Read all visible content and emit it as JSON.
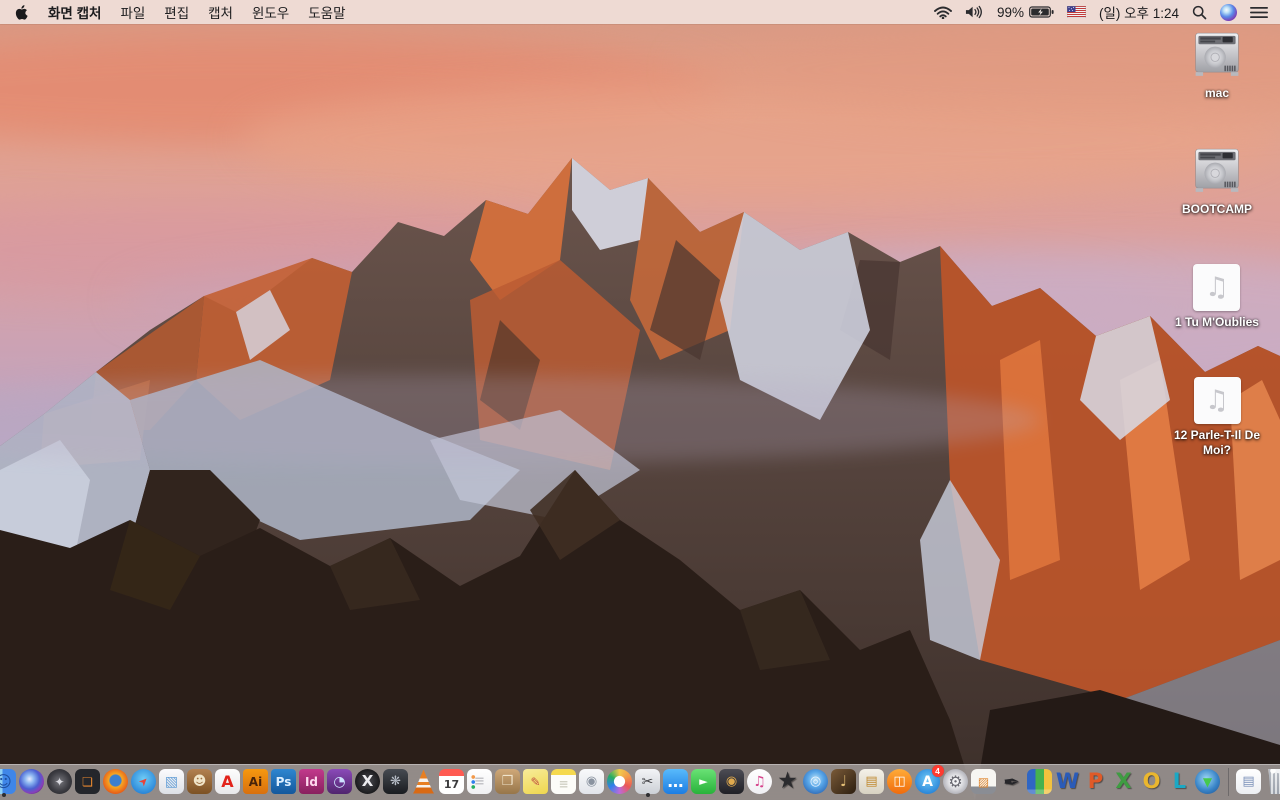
{
  "menu_bar": {
    "app_name": "화면 캡처",
    "menus": [
      "파일",
      "편집",
      "캡처",
      "윈도우",
      "도움말"
    ],
    "status": {
      "battery_percent": "99%",
      "clock": "(일) 오후 1:24",
      "icons": [
        "wifi-icon",
        "volume-icon",
        "battery-charging-icon",
        "us-flag-input-icon",
        "spotlight-icon",
        "siri-icon",
        "notification-center-icon"
      ]
    }
  },
  "desktop": {
    "audio_glyph": "♫",
    "icons": [
      {
        "label": "mac",
        "type": "drive"
      },
      {
        "label": "BOOTCAMP",
        "type": "drive"
      },
      {
        "label": "1 Tu M'Oublies",
        "type": "audio"
      },
      {
        "label": "12 Parle-T-Il De Moi?",
        "type": "audio"
      }
    ]
  },
  "dock": {
    "items": [
      {
        "name": "finder",
        "shape": "round",
        "bg": "linear-gradient(90deg,#8fd0f5 0 46%,#3f86e8 46%)",
        "glyph": "☺",
        "fg": "#1d4fa0",
        "fs": 16,
        "running": true
      },
      {
        "name": "siri",
        "shape": "circle",
        "bg": "radial-gradient(circle at 42% 40%,#e8ecff 0%,#8ab4f0 22%,#4a5fd0 48%,#8a3fb8 68%,#141c30 95%)",
        "glyph": ""
      },
      {
        "name": "launchpad",
        "shape": "circle",
        "bg": "radial-gradient(circle,#77777d 0%,#3c3c42 55%,#202024 100%)",
        "glyph": "✦",
        "fg": "#d8d8de",
        "fs": 12
      },
      {
        "name": "mission-control",
        "shape": "round",
        "bg": "#24262b",
        "glyph": "❏",
        "fg": "#e8882f",
        "fs": 12
      },
      {
        "name": "firefox",
        "shape": "circle",
        "bg": "radial-gradient(circle at 50% 46%,#3b7fd0 0%,#3b7fd0 30%,#f6a623 36%,#e8641a 68%,#c24508 100%)",
        "glyph": ""
      },
      {
        "name": "safari",
        "shape": "circle",
        "bg": "radial-gradient(circle at 50% 40%,#6fcdf7 0%,#2a86d8 75%,#1a6ab8 100%)",
        "glyph": "➤",
        "fg": "#e8433a",
        "fs": 11,
        "rot": -45
      },
      {
        "name": "preview",
        "shape": "round",
        "bg": "linear-gradient(#fbfbfd,#dde0e6)",
        "glyph": "▧",
        "fg": "#6aa2d8",
        "fs": 14
      },
      {
        "name": "contacts",
        "shape": "round",
        "bg": "linear-gradient(#b28050,#7c5224)",
        "glyph": "☻",
        "fg": "#f0e4c8",
        "fs": 13
      },
      {
        "name": "acrobat-reader",
        "shape": "round",
        "bg": "linear-gradient(#fdfdfd,#e8e8ea)",
        "glyph": "A",
        "fg": "#e2231a",
        "fs": 16
      },
      {
        "name": "illustrator",
        "shape": "square",
        "bg": "linear-gradient(#f6980f,#d8700e)",
        "glyph": "Ai",
        "fg": "#47230a",
        "fs": 12
      },
      {
        "name": "photoshop",
        "shape": "square",
        "bg": "linear-gradient(#2e86d0,#15589c)",
        "glyph": "Ps",
        "fg": "#dcefff",
        "fs": 12
      },
      {
        "name": "indesign",
        "shape": "square",
        "bg": "linear-gradient(#c23a8c,#88215e)",
        "glyph": "Id",
        "fg": "#ffd9ee",
        "fs": 12
      },
      {
        "name": "toast-titanium",
        "shape": "round",
        "bg": "linear-gradient(#8a4ab8,#50256e)",
        "glyph": "◔",
        "fg": "#cfe4ff",
        "fs": 14
      },
      {
        "name": "xquartz",
        "shape": "circle",
        "bg": "radial-gradient(circle,#4a4a50 0%,#141416 80%)",
        "glyph": "X",
        "fg": "#ededf0",
        "fs": 15
      },
      {
        "name": "disc-utility",
        "shape": "round",
        "bg": "linear-gradient(#474b52,#1a1c20)",
        "glyph": "❋",
        "fg": "#b8bec8",
        "fs": 13
      },
      {
        "name": "vlc",
        "shape": "cone",
        "glyph": ""
      },
      {
        "name": "calendar",
        "shape": "round",
        "bg": "linear-gradient(#ff5b52 0 27%,#ffffff 27%)",
        "glyph": "17",
        "fg": "#3c3c3e",
        "fs": 11,
        "pad_top": 6
      },
      {
        "name": "reminders",
        "shape": "round",
        "bg": "radial-gradient(circle at 25% 32%,#f2994a 1.6px,transparent 2.1px),radial-gradient(circle at 25% 52%,#2f80ed 1.6px,transparent 2.1px),radial-gradient(circle at 25% 72%,#27ae60 1.6px,transparent 2.1px),linear-gradient(#ffffff,#f0f0f2)",
        "glyph": "≡",
        "fg": "#c4c4c8",
        "fs": 13
      },
      {
        "name": "unarchiver",
        "shape": "round",
        "bg": "linear-gradient(#cfa878,#97764a)",
        "glyph": "❒",
        "fg": "#f0e4cc",
        "fs": 13
      },
      {
        "name": "stickies",
        "shape": "square",
        "bg": "linear-gradient(160deg,#f8ec9a,#eed64e)",
        "glyph": "✎",
        "fg": "#c05040",
        "fs": 12
      },
      {
        "name": "notes",
        "shape": "round",
        "bg": "linear-gradient(#f5d94e 0 24%,#fcfcf8 24%)",
        "glyph": "≡",
        "fg": "#d0d0c4",
        "fs": 12,
        "pad_top": 5
      },
      {
        "name": "image-capture",
        "shape": "round",
        "bg": "linear-gradient(#f8f9fb,#e2e5ea)",
        "glyph": "◉",
        "fg": "#8a93a0",
        "fs": 13
      },
      {
        "name": "photos",
        "shape": "circle",
        "bg": "radial-gradient(circle,#ffffff 30%,rgba(255,255,255,0) 33%),conic-gradient(#f2c94c,#f2994a,#eb5757,#bb6bd9,#2f80ed,#27ae60,#f2c94c)",
        "glyph": ""
      },
      {
        "name": "grab-screen-capture",
        "shape": "round",
        "bg": "linear-gradient(#f3f4f6,#ccd0d6)",
        "glyph": "✂",
        "fg": "#3c3c40",
        "fs": 14,
        "running": true
      },
      {
        "name": "messages",
        "shape": "round",
        "bg": "linear-gradient(#58bafc,#1d7de2)",
        "glyph": "…",
        "fg": "#ffffff",
        "fs": 16
      },
      {
        "name": "facetime",
        "shape": "round",
        "bg": "linear-gradient(#69e275,#28b23a)",
        "glyph": "►",
        "fg": "#ffffff",
        "fs": 11
      },
      {
        "name": "photo-booth",
        "shape": "round",
        "bg": "linear-gradient(#4c4c54,#202026)",
        "glyph": "◉",
        "fg": "#e0aa4e",
        "fs": 13
      },
      {
        "name": "itunes",
        "shape": "circle",
        "bg": "linear-gradient(#ffffff,#f0f0f4)",
        "glyph": "♫",
        "fg": "#d6448c",
        "fs": 14
      },
      {
        "name": "easyfind",
        "shape": "none",
        "glyph": "★",
        "fg": "#2b2b2e",
        "fs": 23
      },
      {
        "name": "dvd-player",
        "shape": "circle",
        "bg": "radial-gradient(circle at 50% 42%,#bfe4f7 0%,#58a6e8 40%,#1c4fa0 100%)",
        "glyph": "◎",
        "fg": "#eaf4ff",
        "fs": 13
      },
      {
        "name": "garageband",
        "shape": "round",
        "bg": "linear-gradient(135deg,#7a5a38,#2c1e10)",
        "glyph": "♩",
        "fg": "#e2bd75",
        "fs": 15
      },
      {
        "name": "publishing-app",
        "shape": "round",
        "bg": "linear-gradient(#f4f1e8,#d8d2c2)",
        "glyph": "▤",
        "fg": "#c08a30",
        "fs": 13
      },
      {
        "name": "ibooks",
        "shape": "circle",
        "bg": "linear-gradient(#ffab38,#f06c0c)",
        "glyph": "◫",
        "fg": "#ffffff",
        "fs": 13
      },
      {
        "name": "app-store",
        "shape": "circle",
        "bg": "radial-gradient(circle at 50% 42%,#6fc9f7 0%,#2a86d8 75%,#1a6ab8 100%)",
        "glyph": "A",
        "fg": "#ffffff",
        "fs": 14,
        "badge": "4"
      },
      {
        "name": "system-preferences",
        "shape": "circle",
        "bg": "radial-gradient(circle,#f2f2f4 25%,#c2c2c8 60%,#8e8e96 100%)",
        "glyph": "⚙",
        "fg": "#6a6a72",
        "fs": 16
      },
      {
        "name": "keynote-09",
        "shape": "round",
        "bg": "linear-gradient(#f7f6f2 0 70%,#8a8d94 70%)",
        "glyph": "▨",
        "fg": "#e0862e",
        "fs": 12
      },
      {
        "name": "pages-09",
        "shape": "none",
        "glyph": "✒",
        "fg": "#26262a",
        "fs": 20
      },
      {
        "name": "numbers-09",
        "shape": "round",
        "bg": "linear-gradient(0deg,rgba(255,255,255,.25) 0 18%,rgba(0,0,0,0) 18%),linear-gradient(90deg,#2f66c4 0 34%,#46b14e 34% 67%,#f2c23e 67%)",
        "glyph": ""
      },
      {
        "name": "word",
        "shape": "none",
        "glyph": "W",
        "fg": "#2a5bb8",
        "fs": 21
      },
      {
        "name": "powerpoint",
        "shape": "none",
        "glyph": "P",
        "fg": "#e05a28",
        "fs": 21
      },
      {
        "name": "excel",
        "shape": "none",
        "glyph": "X",
        "fg": "#3f9c42",
        "fs": 21
      },
      {
        "name": "outlook",
        "shape": "none",
        "glyph": "O",
        "fg": "#eab62e",
        "fs": 21
      },
      {
        "name": "lync",
        "shape": "none",
        "glyph": "L",
        "fg": "#1ba8c4",
        "fs": 21
      },
      {
        "name": "web-downloader",
        "shape": "circle",
        "bg": "radial-gradient(circle at 45% 40%,#9fd8f5 0%,#3a85c8 55%,#1a4e8e 100%)",
        "glyph": "▼",
        "fg": "#46c94e",
        "fs": 12
      },
      {
        "type": "separator"
      },
      {
        "name": "document-file",
        "shape": "round",
        "bg": "linear-gradient(#ffffff,#eceef2)",
        "glyph": "▤",
        "fg": "#7a90b8",
        "fs": 13
      },
      {
        "name": "trash-full",
        "shape": "trash",
        "glyph": ""
      }
    ]
  },
  "colors": {
    "menubar_bg": "#eeddd6",
    "dock_bg": "rgba(233,229,229,0.55)",
    "badge_red": "#ff3b30",
    "label_text": "#ffffff"
  }
}
